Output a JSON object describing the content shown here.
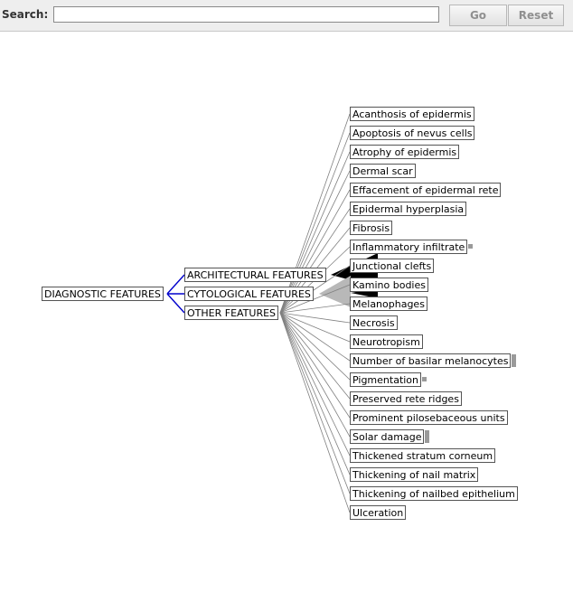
{
  "toolbar": {
    "search_label": "Search:",
    "search_value": "",
    "go_label": "Go",
    "reset_label": "Reset"
  },
  "tree": {
    "root": "DIAGNOSTIC FEATURES",
    "categories": [
      "ARCHITECTURAL FEATURES",
      "CYTOLOGICAL FEATURES",
      "OTHER FEATURES"
    ],
    "leaves": [
      "Acanthosis of epidermis",
      "Apoptosis of nevus cells",
      "Atrophy of epidermis",
      "Dermal scar",
      "Effacement of epidermal rete",
      "Epidermal hyperplasia",
      "Fibrosis",
      "Inflammatory infiltrate",
      "Junctional clefts",
      "Kamino bodies",
      "Melanophages",
      "Necrosis",
      "Neurotropism",
      "Number of basilar melanocytes",
      "Pigmentation",
      "Preserved rete ridges",
      "Prominent pilosebaceous units",
      "Solar damage",
      "Thickened stratum corneum",
      "Thickening of nail matrix",
      "Thickening of nailbed epithelium",
      "Ulceration"
    ],
    "collapsed_markers": [
      "Inflammatory infiltrate",
      "Number of basilar melanocytes",
      "Pigmentation",
      "Solar damage"
    ],
    "colors": {
      "root_link": "#0000cc",
      "links": "#808080",
      "architectural_fan": "#000000",
      "cytological_fan": "#b8b8b8"
    }
  }
}
